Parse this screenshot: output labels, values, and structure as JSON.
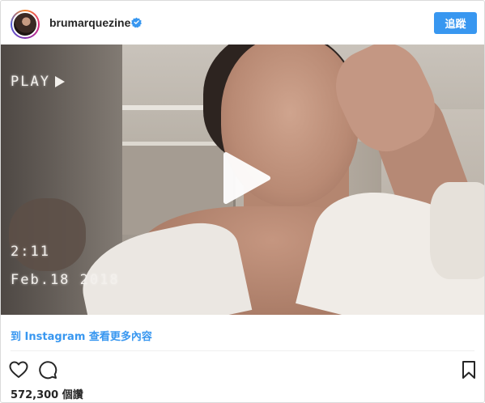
{
  "header": {
    "username": "brumarquezine",
    "verified_badge": "verified-icon",
    "follow_label": "追蹤"
  },
  "video": {
    "overlay_play_text": "PLAY",
    "overlay_time": "2:11",
    "overlay_date": "Feb.18 2018",
    "play_icon": "play-icon"
  },
  "view_more": {
    "label": "到 Instagram 查看更多內容"
  },
  "actions": {
    "like_icon": "heart-icon",
    "comment_icon": "comment-icon",
    "save_icon": "bookmark-icon"
  },
  "stats": {
    "views": "572,300 個讚"
  },
  "colors": {
    "accent": "#3897f0",
    "text": "#262626",
    "border": "#dbdbdb"
  }
}
